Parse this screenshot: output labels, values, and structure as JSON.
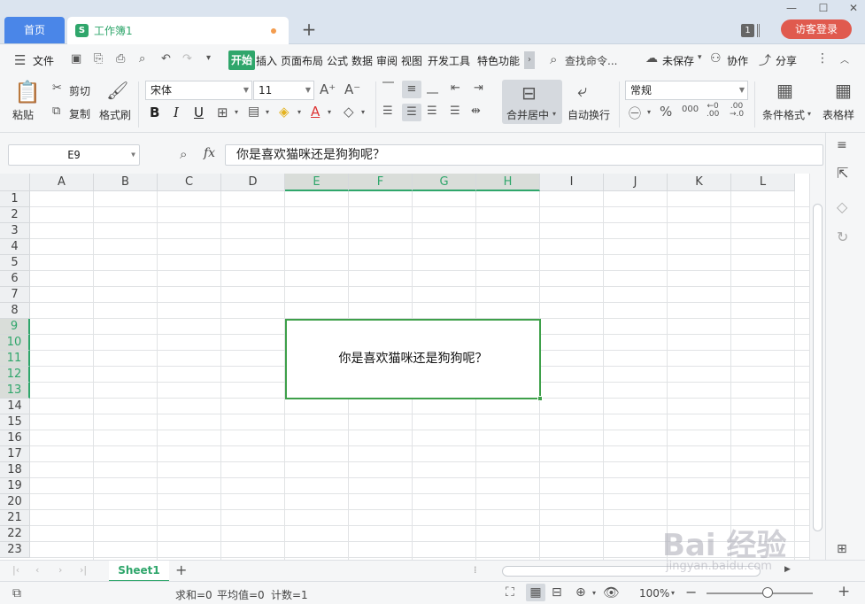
{
  "tabs": {
    "home_label": "首页",
    "doc_title": "工作簿1",
    "doc_icon": "S",
    "add_label": "+"
  },
  "window": {
    "badge": "1",
    "login_label": "访客登录"
  },
  "menu": {
    "file": "文件",
    "items": [
      "开始",
      "插入",
      "页面布局",
      "公式",
      "数据",
      "审阅",
      "视图",
      "开发工具",
      "特色功能"
    ],
    "search_placeholder": "查找命令...",
    "unsaved": "未保存",
    "collaborate": "协作",
    "share": "分享"
  },
  "ribbon": {
    "paste": "粘贴",
    "cut": "剪切",
    "copy": "复制",
    "format_painter": "格式刷",
    "font_name": "宋体",
    "font_size": "11",
    "merge_center": "合并居中",
    "wrap_text": "自动换行",
    "number_format": "常规",
    "conditional_format": "条件格式",
    "table_style": "表格样"
  },
  "formula_bar": {
    "cell_ref": "E9",
    "fx": "fx",
    "value": "你是喜欢猫咪还是狗狗呢？"
  },
  "grid": {
    "columns": [
      "A",
      "B",
      "C",
      "D",
      "E",
      "F",
      "G",
      "H",
      "I",
      "J",
      "K",
      "L"
    ],
    "selected_columns": [
      "E",
      "F",
      "G",
      "H"
    ],
    "rows": [
      "1",
      "2",
      "3",
      "4",
      "5",
      "6",
      "7",
      "8",
      "9",
      "10",
      "11",
      "12",
      "13",
      "14",
      "15",
      "16",
      "17",
      "18",
      "19",
      "20",
      "21",
      "22",
      "23"
    ],
    "selected_rows": [
      "9",
      "10",
      "11",
      "12",
      "13"
    ],
    "merged_cell_text": "你是喜欢猫咪还是狗狗呢？"
  },
  "sheets": {
    "active": "Sheet1",
    "add": "+"
  },
  "status": {
    "sum": "求和=0",
    "average": "平均值=0",
    "count": "计数=1",
    "zoom": "100%"
  },
  "watermark": {
    "brand": "Bai 经验",
    "url": "jingyan.baidu.com"
  },
  "colors": {
    "accent_green": "#2fa66b",
    "selection_border": "#3ea04a",
    "home_tab_blue": "#4a86e8",
    "login_red": "#e05a4e"
  }
}
